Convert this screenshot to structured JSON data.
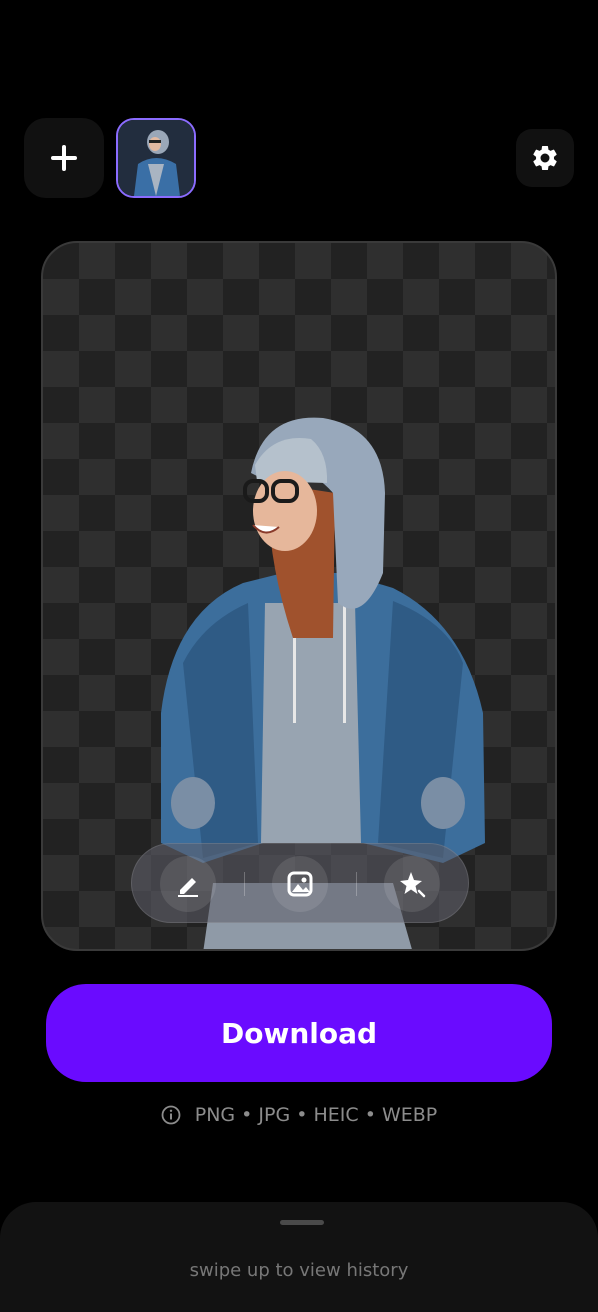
{
  "header": {
    "add_icon": "plus-icon",
    "thumbnail_alt": "selected image",
    "settings_icon": "gear-icon"
  },
  "preview": {
    "background": "transparent-checkerboard",
    "subject": "person in hoodie and denim jacket",
    "toolbar": {
      "items": [
        {
          "icon": "pencil-edit-icon"
        },
        {
          "icon": "image-background-icon"
        },
        {
          "icon": "magic-sparkle-icon"
        }
      ]
    }
  },
  "download": {
    "label": "Download",
    "color": "#6a0bff"
  },
  "formats": {
    "text": "PNG • JPG • HEIC • WEBP",
    "icon": "info-icon"
  },
  "history": {
    "hint": "swipe up to view history"
  },
  "colors": {
    "accent": "#6a0bff",
    "thumbnail_border": "#8b6cff"
  }
}
